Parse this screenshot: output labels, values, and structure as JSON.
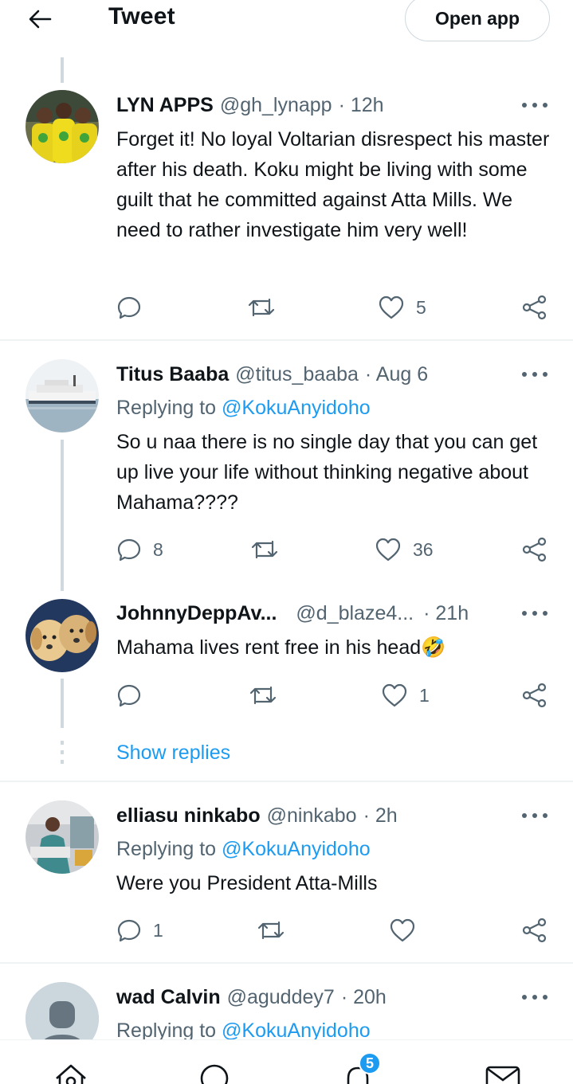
{
  "header": {
    "title": "Tweet",
    "open_app_label": "Open app"
  },
  "tweets": [
    {
      "name": "LYN APPS",
      "handle": "@gh_lynapp",
      "time": "· 12h",
      "replying_label": "",
      "replying_handle": "",
      "text": "Forget it! No loyal Voltarian disrespect his master after his death. Koku might be living with some guilt that he committed against Atta Mills. We need to rather investigate him very well!",
      "replies": "",
      "retweets": "",
      "likes": "5"
    },
    {
      "name": "Titus Baaba",
      "handle": "@titus_baaba",
      "time": "· Aug 6",
      "replying_label": "Replying to",
      "replying_handle": "@KokuAnyidoho",
      "text": "So u naa there is no single day that you can get up live your life without thinking negative about Mahama????",
      "replies": "8",
      "retweets": "",
      "likes": "36"
    },
    {
      "name": "JohnnyDeppAv...",
      "handle": "@d_blaze4...",
      "time": "· 21h",
      "replying_label": "",
      "replying_handle": "",
      "text": "Mahama lives rent free in his head🤣",
      "replies": "",
      "retweets": "",
      "likes": "1"
    },
    {
      "name": "elliasu ninkabo",
      "handle": "@ninkabo",
      "time": "· 2h",
      "replying_label": "Replying to",
      "replying_handle": "@KokuAnyidoho",
      "text": "Were you President Atta-Mills",
      "replies": "1",
      "retweets": "",
      "likes": ""
    },
    {
      "name": "wad Calvin",
      "handle": "@aguddey7",
      "time": "· 20h",
      "replying_label": "Replying to",
      "replying_handle": "@KokuAnyidoho",
      "text": "",
      "replies": "",
      "retweets": "",
      "likes": ""
    }
  ],
  "show_replies_label": "Show replies",
  "nav": {
    "notifications_badge": "5",
    "items": [
      "home-icon",
      "search-icon",
      "notifications-icon",
      "messages-icon"
    ]
  },
  "colors": {
    "accent": "#1d9bf0",
    "text": "#0f1419",
    "secondary": "#536471",
    "border": "#eff3f4"
  }
}
